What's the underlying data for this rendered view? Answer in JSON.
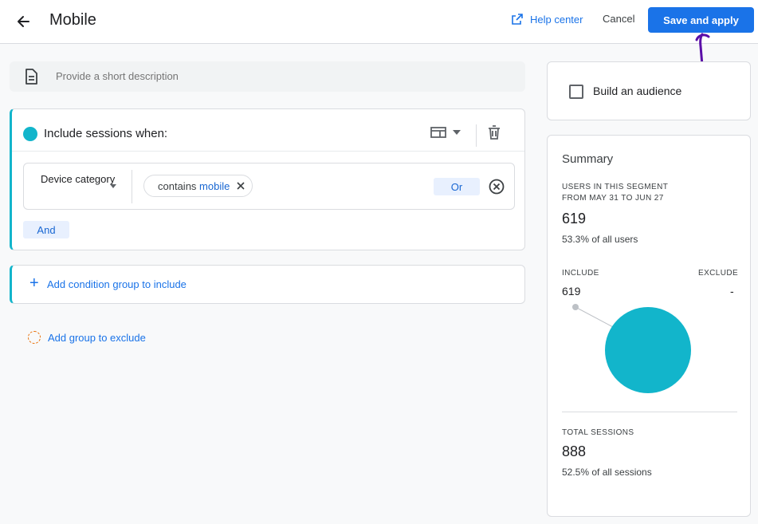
{
  "header": {
    "title": "Mobile",
    "help_label": "Help center",
    "cancel_label": "Cancel",
    "save_label": "Save and apply"
  },
  "description": {
    "placeholder": "Provide a short description"
  },
  "include": {
    "title": "Include sessions when:",
    "dimension": "Device category",
    "condition_operator": "contains",
    "condition_value": "mobile",
    "or_label": "Or",
    "and_label": "And"
  },
  "add_condition_group_label": "Add condition group to include",
  "add_exclude_label": "Add group to exclude",
  "audience": {
    "label": "Build an audience",
    "checked": false
  },
  "summary": {
    "title": "Summary",
    "users_label_line1": "USERS IN THIS SEGMENT",
    "users_label_line2": "FROM MAY 31 TO JUN 27",
    "users_value": "619",
    "users_pct": "53.3% of all users",
    "include_label": "INCLUDE",
    "exclude_label": "EXCLUDE",
    "include_value": "619",
    "exclude_value": "-",
    "sessions_label": "TOTAL SESSIONS",
    "sessions_value": "888",
    "sessions_pct": "52.5% of all sessions"
  },
  "colors": {
    "accent": "#1a73e8",
    "segment": "#12b5cb",
    "exclude_outline": "#e8710a"
  },
  "icons": {
    "back": "arrow-left-icon",
    "help": "open-in-new-icon",
    "description": "document-icon",
    "scope": "table-view-icon",
    "delete": "trash-icon",
    "remove": "close-circle-icon"
  }
}
